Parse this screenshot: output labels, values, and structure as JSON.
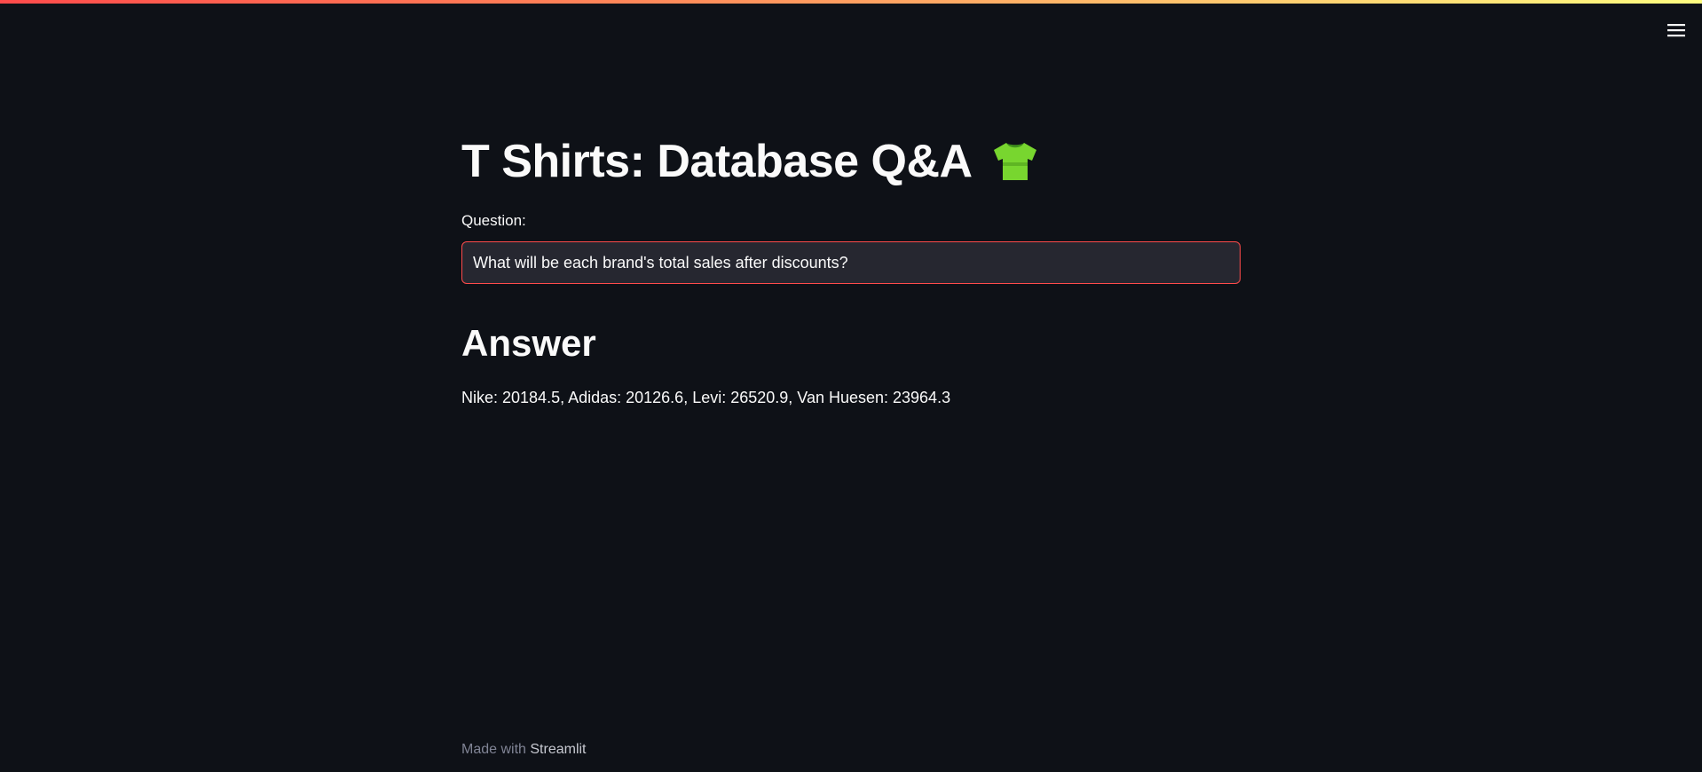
{
  "app": {
    "title": "T Shirts: Database Q&A",
    "title_icon": "tshirt-icon",
    "accent_gradient": [
      "#ff4b4b",
      "#fffd80"
    ],
    "background": "#0e1117"
  },
  "header": {
    "menu_icon": "hamburger-menu-icon"
  },
  "form": {
    "question_label": "Question:",
    "question_value": "What will be each brand's total sales after discounts?"
  },
  "answer": {
    "heading": "Answer",
    "text": "Nike: 20184.5, Adidas: 20126.6, Levi: 26520.9, Van Huesen: 23964.3"
  },
  "footer": {
    "prefix": "Made with ",
    "brand": "Streamlit"
  }
}
